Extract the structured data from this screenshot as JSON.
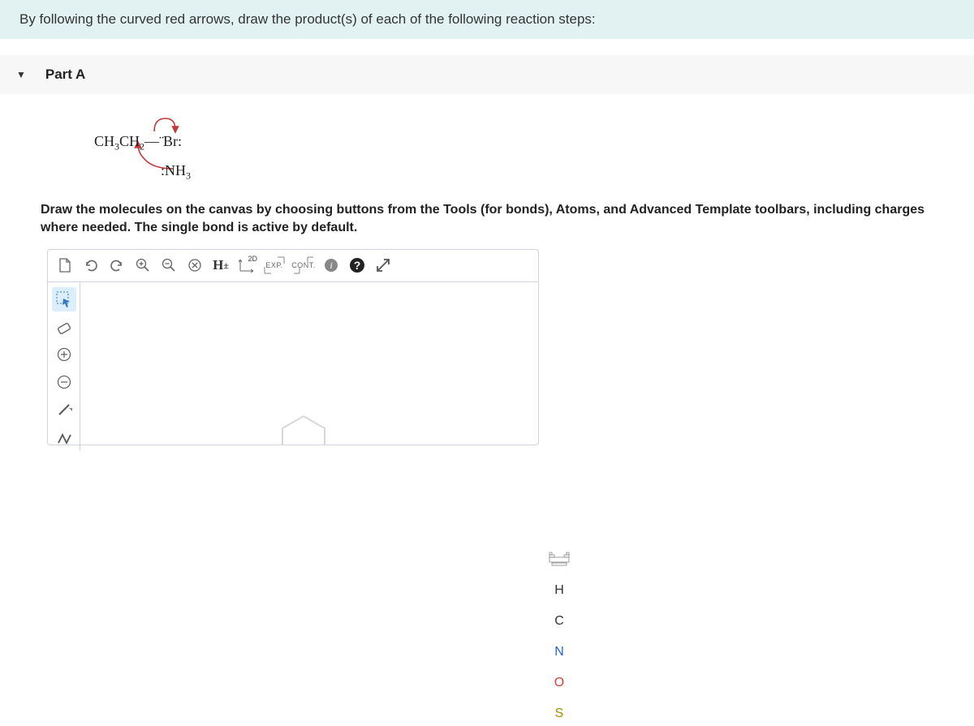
{
  "instruction": "By following the curved red arrows, draw the product(s) of each of the following reaction steps:",
  "part": {
    "label": "Part A"
  },
  "reaction": {
    "reactant_left": "CH",
    "reactant_sub1": "3",
    "reactant_mid": "CH",
    "reactant_sub2": "2",
    "bond": "—",
    "leaving": "Br",
    "nucleophile_prefix": ":",
    "nucleophile": "NH",
    "nucleophile_sub": "3"
  },
  "sub_instruction": "Draw the molecules on the canvas by choosing buttons from the Tools (for bonds), Atoms, and Advanced Template toolbars, including charges where needed. The single bond is active by default.",
  "toolbar": {
    "h_toggle": "H",
    "h_toggle_sup": "±",
    "twod_label": "2D",
    "exp_label": "EXP.",
    "cont_label": "CONT."
  },
  "atoms": {
    "h": "H",
    "c": "C",
    "n": "N",
    "o": "O",
    "s": "S"
  }
}
